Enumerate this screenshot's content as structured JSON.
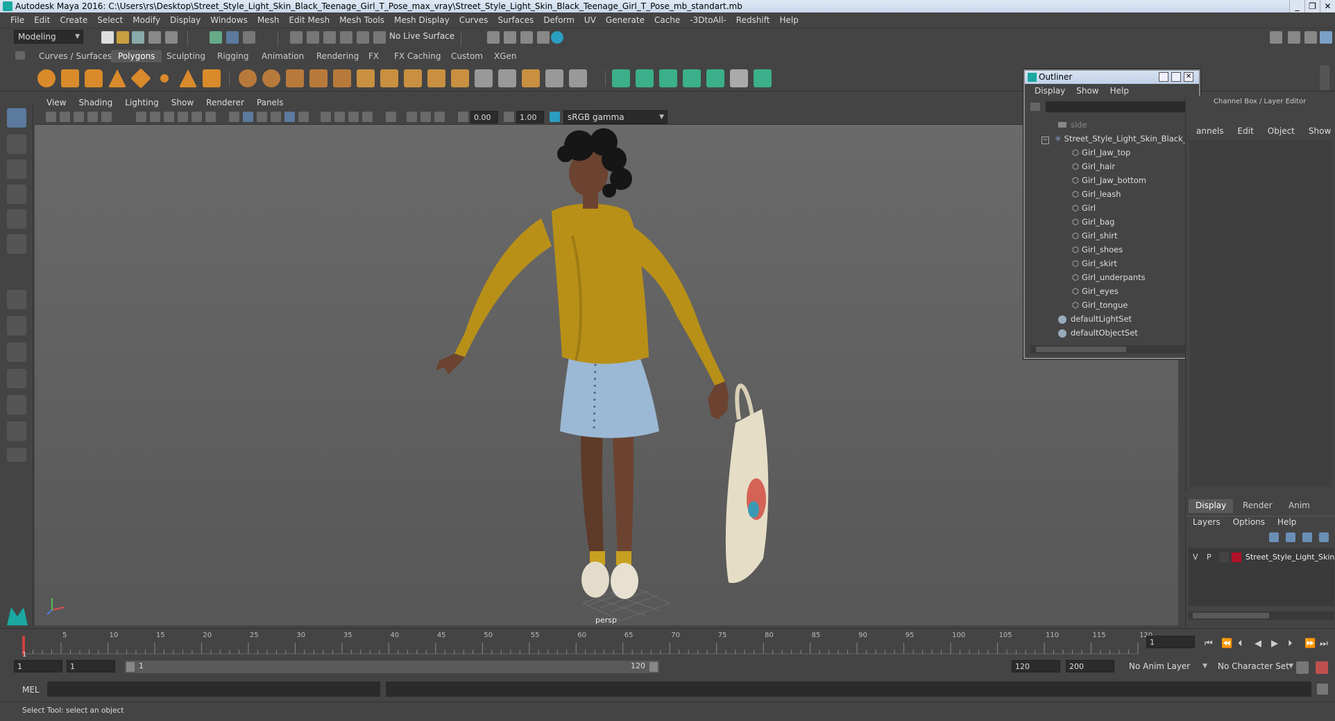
{
  "window": {
    "title": "Autodesk Maya 2016: C:\\Users\\rs\\Desktop\\Street_Style_Light_Skin_Black_Teenage_Girl_T_Pose_max_vray\\Street_Style_Light_Skin_Black_Teenage_Girl_T_Pose_mb_standart.mb"
  },
  "menubar": [
    "File",
    "Edit",
    "Create",
    "Select",
    "Modify",
    "Display",
    "Windows",
    "Mesh",
    "Edit Mesh",
    "Mesh Tools",
    "Mesh Display",
    "Curves",
    "Surfaces",
    "Deform",
    "UV",
    "Generate",
    "Cache",
    "-3DtoAll-",
    "Redshift",
    "Help"
  ],
  "statusline": {
    "mode": "Modeling",
    "live_surface": "No Live Surface"
  },
  "shelf_tabs": [
    "Curves / Surfaces",
    "Polygons",
    "Sculpting",
    "Rigging",
    "Animation",
    "Rendering",
    "FX",
    "FX Caching",
    "Custom",
    "XGen"
  ],
  "shelf_active_tab": "Polygons",
  "viewport": {
    "menu": [
      "View",
      "Shading",
      "Lighting",
      "Show",
      "Renderer",
      "Panels"
    ],
    "exposure": "0.00",
    "gamma": "1.00",
    "color_space": "sRGB gamma",
    "camera_label": "persp"
  },
  "outliner": {
    "title": "Outliner",
    "menu": [
      "Display",
      "Show",
      "Help"
    ],
    "rows": [
      {
        "label": "side",
        "type": "camera"
      },
      {
        "label": "Street_Style_Light_Skin_Black_Tee",
        "type": "group"
      },
      {
        "label": "Girl_Jaw_top",
        "type": "mesh"
      },
      {
        "label": "Girl_hair",
        "type": "mesh"
      },
      {
        "label": "Girl_Jaw_bottom",
        "type": "mesh"
      },
      {
        "label": "Girl_leash",
        "type": "mesh"
      },
      {
        "label": "Girl",
        "type": "mesh"
      },
      {
        "label": "Girl_bag",
        "type": "mesh"
      },
      {
        "label": "Girl_shirt",
        "type": "mesh"
      },
      {
        "label": "Girl_shoes",
        "type": "mesh"
      },
      {
        "label": "Girl_skirt",
        "type": "mesh"
      },
      {
        "label": "Girl_underpants",
        "type": "mesh"
      },
      {
        "label": "Girl_eyes",
        "type": "mesh"
      },
      {
        "label": "Girl_tongue",
        "type": "mesh"
      },
      {
        "label": "defaultLightSet",
        "type": "set"
      },
      {
        "label": "defaultObjectSet",
        "type": "set"
      }
    ]
  },
  "channelbox": {
    "title": "Channel Box / Layer Editor",
    "menu": [
      "annels",
      "Edit",
      "Object",
      "Show"
    ]
  },
  "layers": {
    "tabs": [
      "Display",
      "Render",
      "Anim"
    ],
    "menu": [
      "Layers",
      "Options",
      "Help"
    ],
    "layer": {
      "v": "V",
      "p": "P",
      "name": "Street_Style_Light_Skin",
      "color": "#b0122a"
    }
  },
  "timeline": {
    "ticks": [
      "5",
      "10",
      "15",
      "20",
      "25",
      "30",
      "35",
      "40",
      "45",
      "50",
      "55",
      "60",
      "65",
      "70",
      "75",
      "80",
      "85",
      "90",
      "95",
      "100",
      "105",
      "110",
      "115",
      "120"
    ],
    "current_marker": "1",
    "current_frame": "1"
  },
  "range": {
    "start": "1",
    "inner_start": "1",
    "slider_start": "1",
    "slider_end": "120",
    "inner_end": "120",
    "end": "200",
    "anim_layer": "No Anim Layer",
    "character_set": "No Character Set"
  },
  "cmdline": {
    "label": "MEL"
  },
  "helpline": {
    "text": "Select Tool: select an object"
  },
  "colors": {
    "sweater": "#b89018",
    "skirt": "#9bb8d4",
    "skin": "#6b4330",
    "hair": "#161616",
    "bag": "#e6ddc6",
    "selection_accent": "#5b7a9e"
  }
}
